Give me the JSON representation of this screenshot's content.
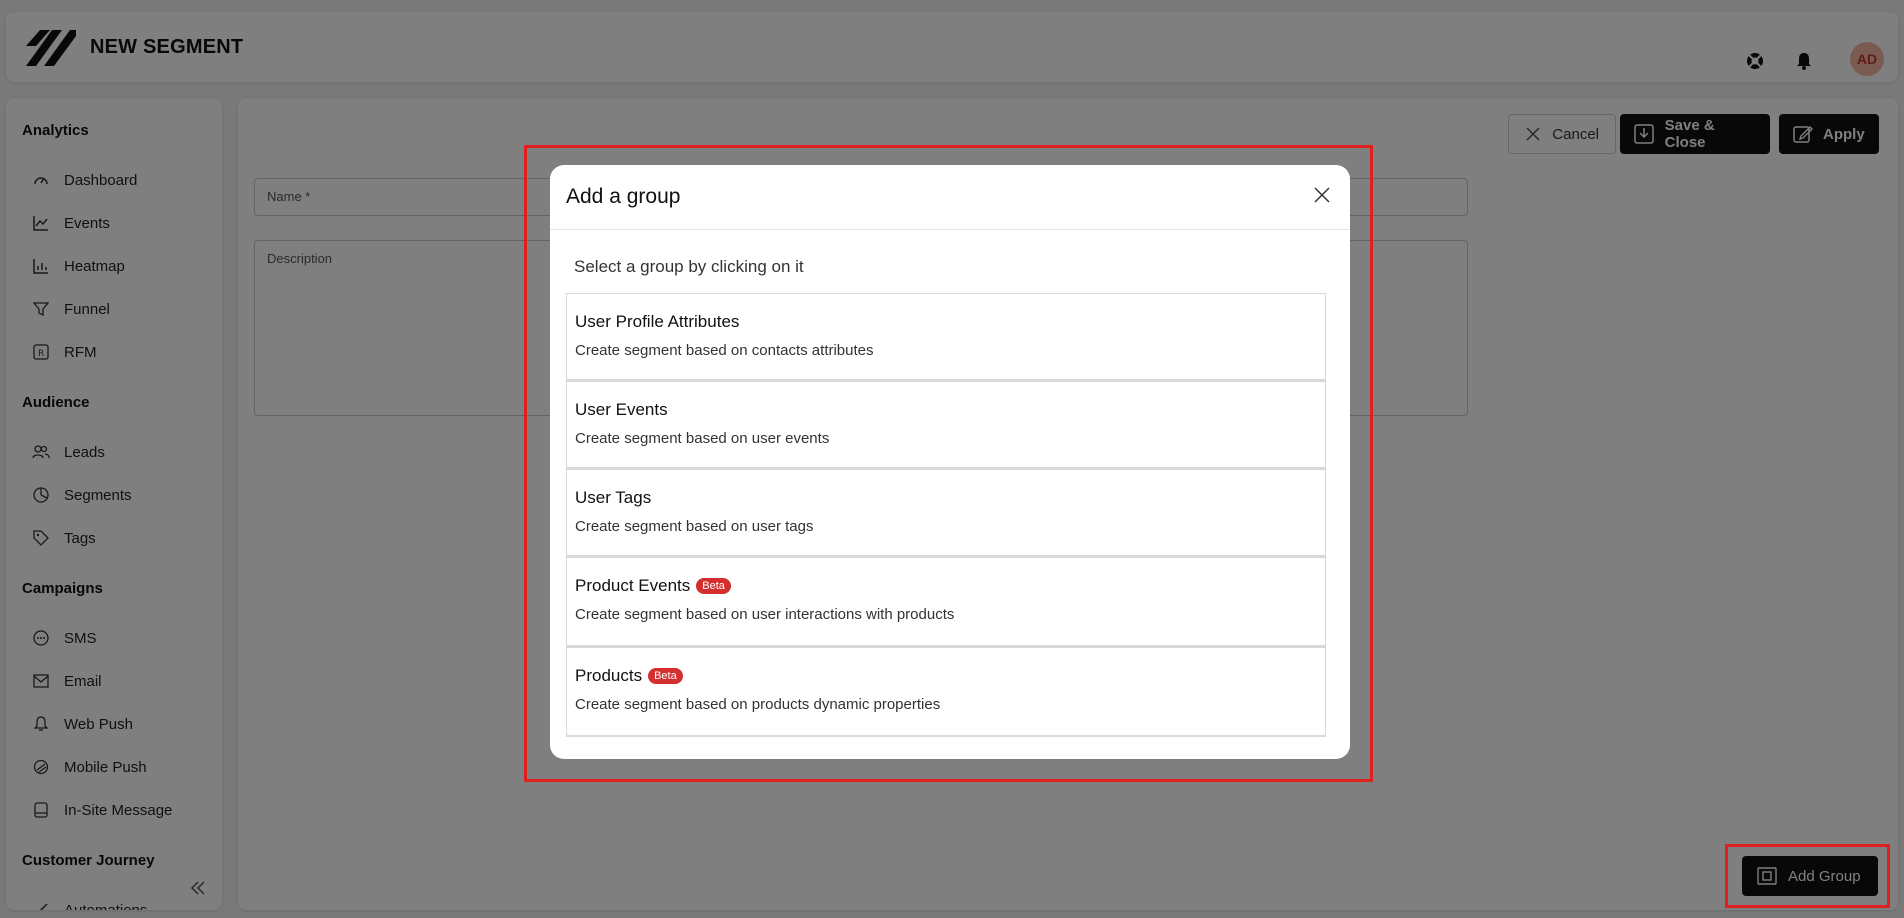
{
  "header": {
    "title": "NEW SEGMENT",
    "avatar_initials": "AD",
    "icons": [
      "help-icon",
      "bell-icon"
    ]
  },
  "sidebar": {
    "sections": [
      {
        "label": "Analytics",
        "items": [
          {
            "label": "Dashboard",
            "icon": "dashboard-icon"
          },
          {
            "label": "Events",
            "icon": "chart-line-icon"
          },
          {
            "label": "Heatmap",
            "icon": "bar-chart-icon"
          },
          {
            "label": "Funnel",
            "icon": "funnel-icon"
          },
          {
            "label": "RFM",
            "icon": "rfm-icon"
          }
        ]
      },
      {
        "label": "Audience",
        "items": [
          {
            "label": "Leads",
            "icon": "users-icon"
          },
          {
            "label": "Segments",
            "icon": "pie-icon"
          },
          {
            "label": "Tags",
            "icon": "tag-icon"
          }
        ]
      },
      {
        "label": "Campaigns",
        "items": [
          {
            "label": "SMS",
            "icon": "chat-icon"
          },
          {
            "label": "Email",
            "icon": "mail-icon"
          },
          {
            "label": "Web Push",
            "icon": "bell-icon"
          },
          {
            "label": "Mobile Push",
            "icon": "mobile-push-icon"
          },
          {
            "label": "In-Site Message",
            "icon": "message-icon"
          }
        ]
      },
      {
        "label": "Customer Journey",
        "items": [
          {
            "label": "Automations",
            "icon": "automation-icon"
          }
        ]
      }
    ]
  },
  "toolbar": {
    "cancel_label": "Cancel",
    "save_close_label": "Save & Close",
    "apply_label": "Apply",
    "add_group_label": "Add Group"
  },
  "form": {
    "name_placeholder": "Name *",
    "description_placeholder": "Description"
  },
  "modal": {
    "title": "Add a group",
    "subtitle": "Select a group by clicking on it",
    "groups": [
      {
        "title": "User Profile Attributes",
        "desc": "Create segment based on contacts attributes",
        "badge": ""
      },
      {
        "title": "User Events",
        "desc": "Create segment based on user events",
        "badge": ""
      },
      {
        "title": "User Tags",
        "desc": "Create segment based on user tags",
        "badge": ""
      },
      {
        "title": "Product Events",
        "desc": "Create segment based on user interactions with products",
        "badge": "Beta"
      },
      {
        "title": "Products",
        "desc": "Create segment based on products dynamic properties",
        "badge": "Beta"
      }
    ]
  },
  "colors": {
    "accent": "#111111",
    "badge": "#d32f2f",
    "highlight": "#e0201c",
    "avatar_bg": "#f5b7a4"
  }
}
